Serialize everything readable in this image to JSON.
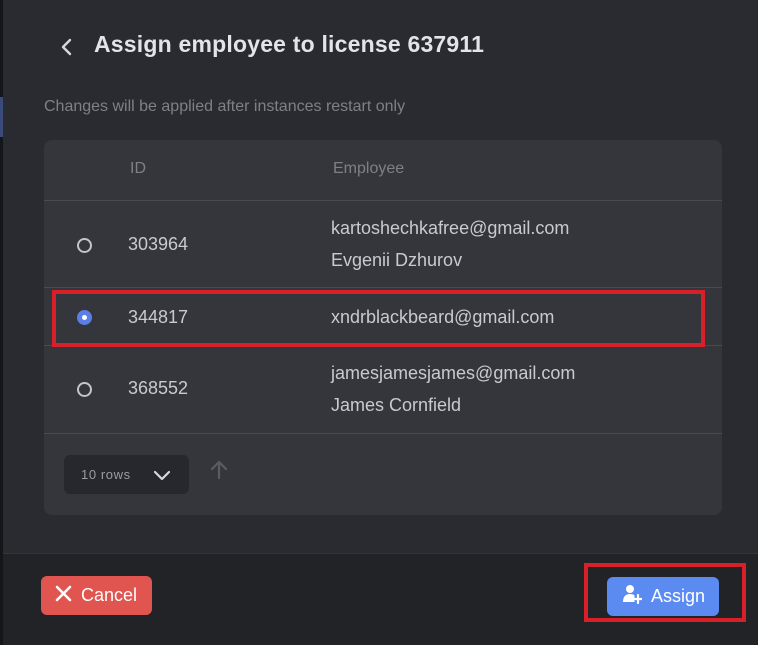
{
  "dialog": {
    "title": "Assign employee to license 637911",
    "subtitle": "Changes will be applied after instances restart only",
    "back_icon": "chevron-left-icon"
  },
  "table": {
    "columns": [
      "ID",
      "Employee"
    ],
    "rows": [
      {
        "id": "303964",
        "email": "kartoshechkafree@gmail.com",
        "name": "Evgenii Dzhurov",
        "selected": false
      },
      {
        "id": "344817",
        "email": "xndrblackbeard@gmail.com",
        "name": "",
        "selected": true
      },
      {
        "id": "368552",
        "email": "jamesjamesjames@gmail.com",
        "name": "James Cornfield",
        "selected": false
      }
    ],
    "rows_per_page": "10 rows",
    "sort_icon": "arrow-up-icon"
  },
  "actions": {
    "cancel_label": "Cancel",
    "cancel_icon": "close-icon",
    "assign_label": "Assign",
    "assign_icon": "add-user-icon"
  },
  "colors": {
    "background": "#2a2b30",
    "table": "#35363c",
    "accent": "#5b8af0",
    "danger": "#e0554f",
    "highlight": "#d8202a"
  }
}
